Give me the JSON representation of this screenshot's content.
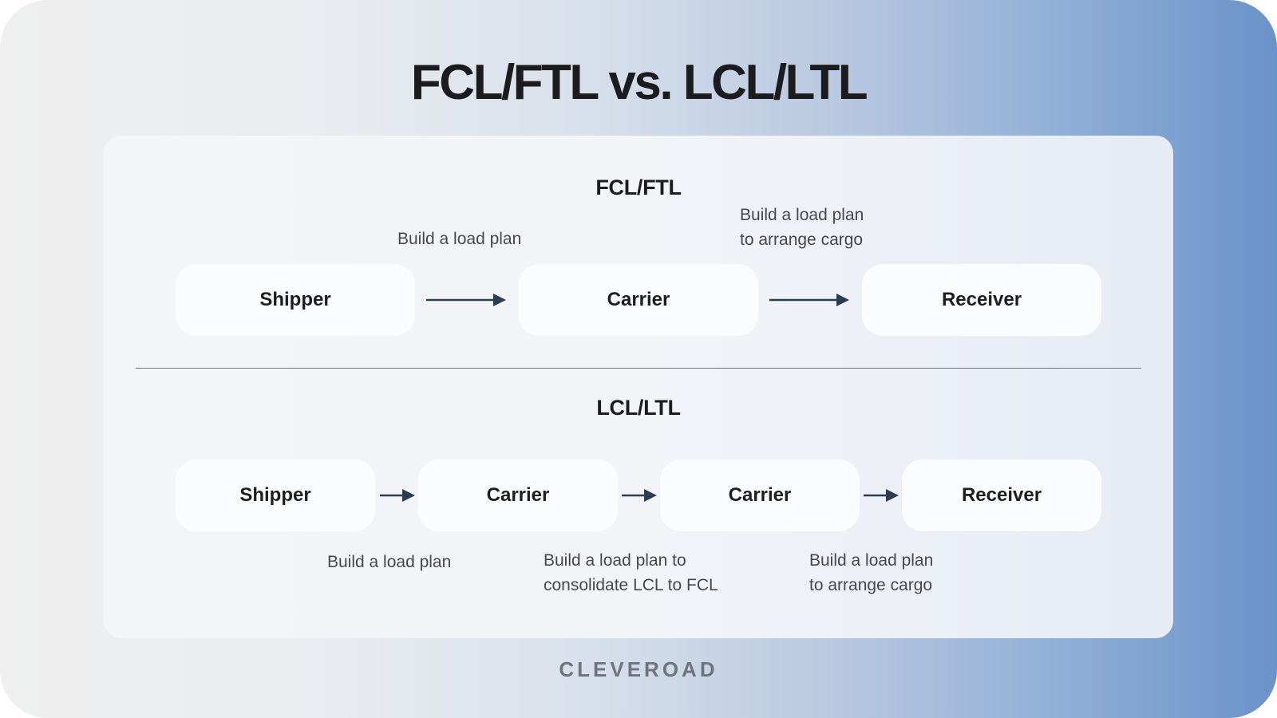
{
  "title": "FCL/FTL vs. LCL/LTL",
  "brand": "CLEVEROAD",
  "colors": {
    "arrow": "#2b3d52",
    "accent_blue": "#6a93c9",
    "text_dark": "#1c1c1e",
    "text_label": "#45484d"
  },
  "fcl": {
    "heading": "FCL/FTL",
    "nodes": [
      "Shipper",
      "Carrier",
      "Receiver"
    ],
    "steps": [
      {
        "lines": [
          "Build a load plan"
        ]
      },
      {
        "lines": [
          "Build a load plan",
          "to arrange cargo"
        ]
      }
    ]
  },
  "lcl": {
    "heading": "LCL/LTL",
    "nodes": [
      "Shipper",
      "Carrier",
      "Carrier",
      "Receiver"
    ],
    "steps": [
      {
        "lines": [
          "Build a load plan"
        ]
      },
      {
        "lines": [
          "Build a load plan to",
          "consolidate LCL to FCL"
        ]
      },
      {
        "lines": [
          "Build a load plan",
          "to arrange cargo"
        ]
      }
    ]
  }
}
